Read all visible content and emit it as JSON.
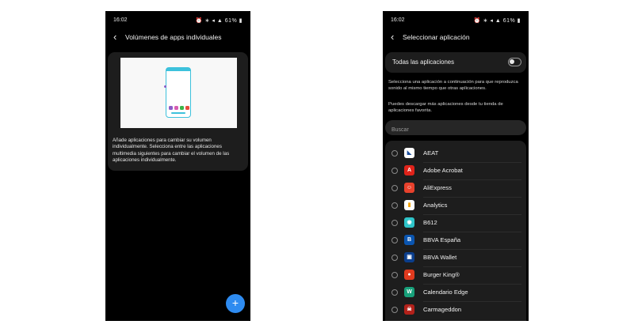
{
  "left_screen": {
    "status": {
      "time": "16:02",
      "icons": "⏰ ∗ ◂ ▲ 61% ▮"
    },
    "header": {
      "back": "‹",
      "title": "Volúmenes de apps individuales"
    },
    "description": "Añade aplicaciones para cambiar su volumen individualmente. Selecciona entre las aplicaciones multimedia siguientes para cambiar el volumen de las aplicaciones individualmente.",
    "fab": "+",
    "colors": {
      "preview_accent": "#3dc1dc",
      "fab": "#2e8bf0"
    }
  },
  "right_screen": {
    "status": {
      "time": "16:02",
      "icons": "⏰ ∗ ◂ ▲ 61% ▮"
    },
    "header": {
      "back": "‹",
      "title": "Seleccionar aplicación"
    },
    "all_apps": {
      "label": "Todas las aplicaciones",
      "enabled": false
    },
    "info1": "Selecciona una aplicación a continuación para que reproduzca sonido al mismo tiempo que otras aplicaciones.",
    "info2": "Puedes descargar más aplicaciones desde tu tienda de aplicaciones favorita.",
    "search_placeholder": "Buscar",
    "apps": [
      {
        "name": "AEAT",
        "icon": "aeat-icon",
        "glyph": "◣",
        "color": "#ffffff"
      },
      {
        "name": "Adobe Acrobat",
        "icon": "adobe-acrobat-icon",
        "glyph": "A",
        "color": "#e0231a"
      },
      {
        "name": "AliExpress",
        "icon": "aliexpress-icon",
        "glyph": "☺",
        "color": "#e8412c"
      },
      {
        "name": "Analytics",
        "icon": "analytics-icon",
        "glyph": "▮",
        "color": "#ffffff"
      },
      {
        "name": "B612",
        "icon": "b612-icon",
        "glyph": "◉",
        "color": "#2ec4c9"
      },
      {
        "name": "BBVA España",
        "icon": "bbva-espana-icon",
        "glyph": "B",
        "color": "#0a55b0"
      },
      {
        "name": "BBVA Wallet",
        "icon": "bbva-wallet-icon",
        "glyph": "▣",
        "color": "#0b3e8c"
      },
      {
        "name": "Burger King®",
        "icon": "burger-king-icon",
        "glyph": "●",
        "color": "#e03a1e"
      },
      {
        "name": "Calendario Edge",
        "icon": "calendario-edge-icon",
        "glyph": "W",
        "color": "#17a07a"
      },
      {
        "name": "Carmageddon",
        "icon": "carmageddon-icon",
        "glyph": "☠",
        "color": "#b3211a"
      }
    ]
  }
}
